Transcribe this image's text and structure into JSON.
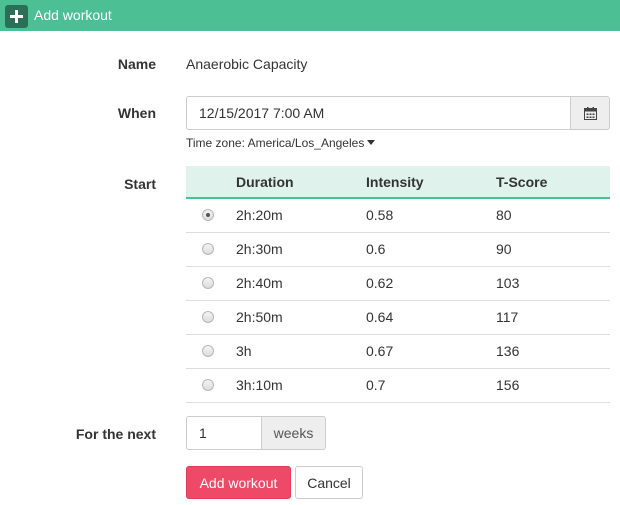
{
  "header": {
    "title": "Add workout",
    "icon": "plus-icon",
    "color": "#4cbf94"
  },
  "form": {
    "name_label": "Name",
    "name_value": "Anaerobic Capacity",
    "when_label": "When",
    "when_value": "12/15/2017 7:00 AM",
    "calendar_icon": "calendar-icon",
    "timezone_text": "Time zone: America/Los_Angeles",
    "start_label": "Start",
    "for_next_label": "For the next",
    "for_next_value": "1",
    "for_next_unit": "weeks"
  },
  "table": {
    "headers": [
      "Duration",
      "Intensity",
      "T-Score"
    ],
    "header_bg": "#dff2ec",
    "rows": [
      {
        "duration": "2h:20m",
        "intensity": "0.58",
        "tscore": "80",
        "selected": true
      },
      {
        "duration": "2h:30m",
        "intensity": "0.6",
        "tscore": "90",
        "selected": false
      },
      {
        "duration": "2h:40m",
        "intensity": "0.62",
        "tscore": "103",
        "selected": false
      },
      {
        "duration": "2h:50m",
        "intensity": "0.64",
        "tscore": "117",
        "selected": false
      },
      {
        "duration": "3h",
        "intensity": "0.67",
        "tscore": "136",
        "selected": false
      },
      {
        "duration": "3h:10m",
        "intensity": "0.7",
        "tscore": "156",
        "selected": false
      }
    ]
  },
  "buttons": {
    "add_label": "Add workout",
    "add_color": "#ee4a67",
    "cancel_label": "Cancel"
  }
}
